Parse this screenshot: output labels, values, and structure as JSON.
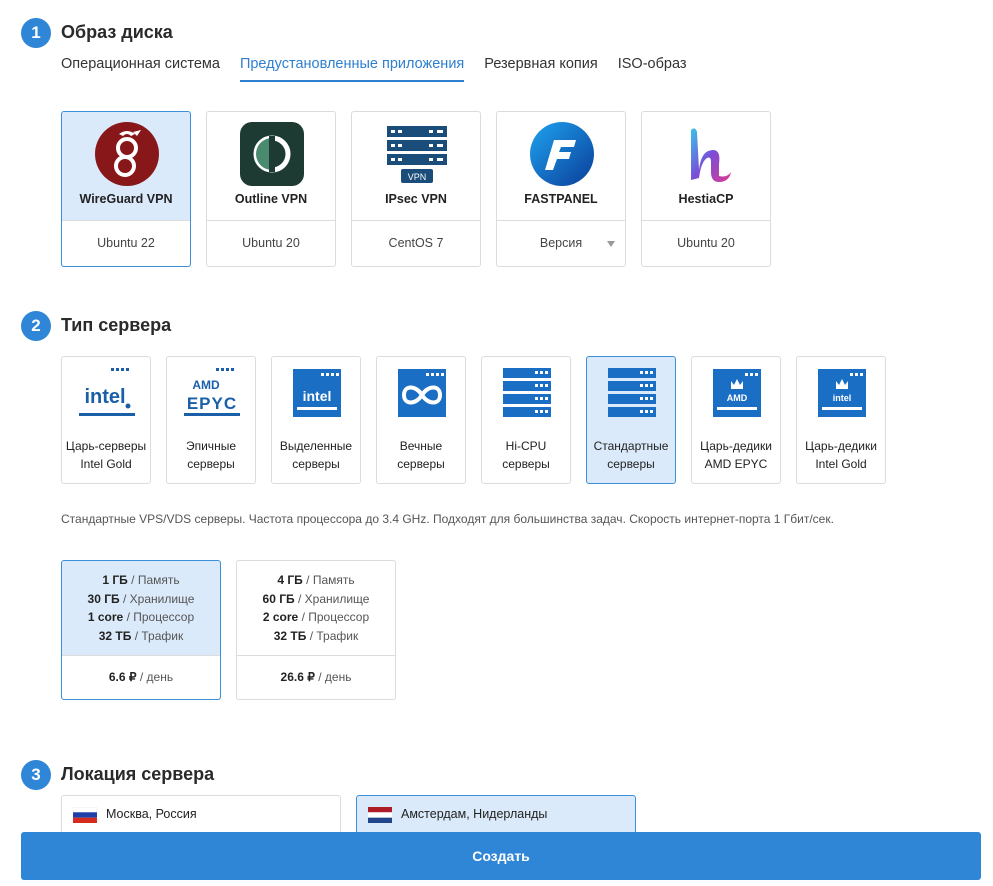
{
  "sections": {
    "image": {
      "number": "1",
      "title": "Образ диска"
    },
    "server_type": {
      "number": "2",
      "title": "Тип сервера"
    },
    "location": {
      "number": "3",
      "title": "Локация сервера"
    }
  },
  "tabs": [
    {
      "label": "Операционная система",
      "active": false
    },
    {
      "label": "Предустановленные приложения",
      "active": true
    },
    {
      "label": "Резервная копия",
      "active": false
    },
    {
      "label": "ISO-образ",
      "active": false
    }
  ],
  "apps": [
    {
      "icon": "wireguard-icon",
      "name": "WireGuard VPN",
      "version": "Ubuntu 22",
      "selected": true
    },
    {
      "icon": "outline-icon",
      "name": "Outline VPN",
      "version": "Ubuntu 20",
      "selected": false
    },
    {
      "icon": "ipsec-server-icon",
      "name": "IPsec VPN",
      "version": "CentOS 7",
      "selected": false,
      "badge": "VPN"
    },
    {
      "icon": "fastpanel-icon",
      "name": "FASTPANEL",
      "version": "Версия",
      "selected": false,
      "dropdown": true
    },
    {
      "icon": "hestiacp-icon",
      "name": "HestiaCP",
      "version": "Ubuntu 20",
      "selected": false
    }
  ],
  "server_types": [
    {
      "icon": "intel-gold-icon",
      "line1": "Царь-серверы",
      "line2": "Intel Gold",
      "selected": false
    },
    {
      "icon": "amd-epyc-icon",
      "line1": "Эпичные",
      "line2": "серверы",
      "selected": false
    },
    {
      "icon": "intel-chip-icon",
      "line1": "Выделенные",
      "line2": "серверы",
      "selected": false
    },
    {
      "icon": "infinity-icon",
      "line1": "Вечные",
      "line2": "серверы",
      "selected": false
    },
    {
      "icon": "server-rack-icon",
      "line1": "Hi-CPU",
      "line2": "серверы",
      "selected": false
    },
    {
      "icon": "server-rack-icon",
      "line1": "Стандартные",
      "line2": "серверы",
      "selected": true
    },
    {
      "icon": "amd-crown-icon",
      "line1": "Царь-дедики",
      "line2": "AMD EPYC",
      "selected": false
    },
    {
      "icon": "intel-crown-icon",
      "line1": "Царь-дедики",
      "line2": "Intel Gold",
      "selected": false
    }
  ],
  "server_type_logo_text": {
    "intel": "intel",
    "amd": "AMD",
    "epyc": "EPYC"
  },
  "server_type_description": "Стандартные VPS/VDS серверы. Частота процессора до 3.4 GHz. Подходят для большинства задач. Скорость интернет-порта 1 Гбит/сек.",
  "plans": [
    {
      "memory": "1 ГБ",
      "storage": "30 ГБ",
      "cpu": "1 core",
      "traffic": "32 ТБ",
      "price": "6.6 ₽",
      "selected": true
    },
    {
      "memory": "4 ГБ",
      "storage": "60 ГБ",
      "cpu": "2 core",
      "traffic": "32 ТБ",
      "price": "26.6 ₽",
      "selected": false
    }
  ],
  "plan_labels": {
    "memory": "/ Память",
    "storage": "/ Хранилище",
    "cpu": "/ Процессор",
    "traffic": "/ Трафик",
    "per_day": "/ день"
  },
  "locations": [
    {
      "flag": "russia-flag",
      "name": "Москва, Россия",
      "selected": false
    },
    {
      "flag": "netherlands-flag",
      "name": "Амстердам, Нидерланды",
      "selected": true
    }
  ],
  "create_button": "Создать",
  "colors": {
    "accent": "#2f86d6",
    "selected_bg": "#dbeafa",
    "selected_border": "#3d8fd9"
  }
}
